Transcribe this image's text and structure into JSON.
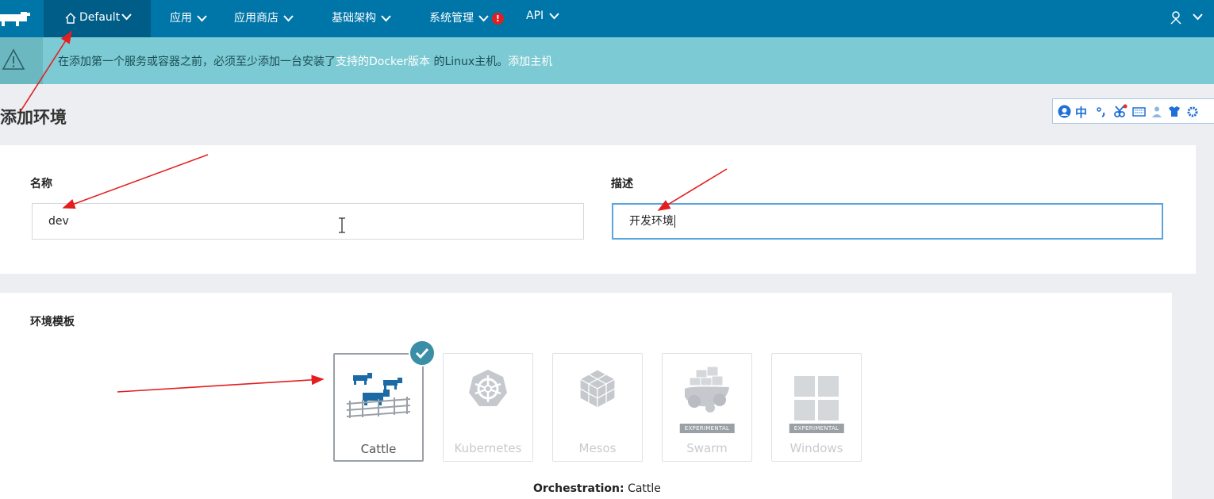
{
  "nav": {
    "env_name": "Default",
    "menus": [
      "应用",
      "应用商店",
      "基础架构",
      "系统管理",
      "API"
    ],
    "alert_mark": "!",
    "colors": {
      "nav_bg": "#0075a8",
      "env_bg": "#005d87"
    }
  },
  "banner": {
    "text_before": "在添加第一个服务或容器之前，必须至少添加一台安装了",
    "link_docker": "支持的Docker版本",
    "text_middle": " 的Linux主机。",
    "link_add_host": "添加主机",
    "color": "#7ccad3"
  },
  "page": {
    "title": "添加环境"
  },
  "ime_toolbar": {
    "lang": "中"
  },
  "form": {
    "name_label": "名称",
    "name_value": "dev",
    "desc_label": "描述",
    "desc_value": "开发环境"
  },
  "templates": {
    "label": "环境模板",
    "items": [
      {
        "name": "Cattle",
        "selected": true,
        "badge": ""
      },
      {
        "name": "Kubernetes",
        "selected": false,
        "badge": ""
      },
      {
        "name": "Mesos",
        "selected": false,
        "badge": ""
      },
      {
        "name": "Swarm",
        "selected": false,
        "badge": "EXPERIMENTAL"
      },
      {
        "name": "Windows",
        "selected": false,
        "badge": "EXPERIMENTAL"
      }
    ],
    "orchestration_label": "Orchestration:",
    "orchestration_value": "Cattle"
  }
}
